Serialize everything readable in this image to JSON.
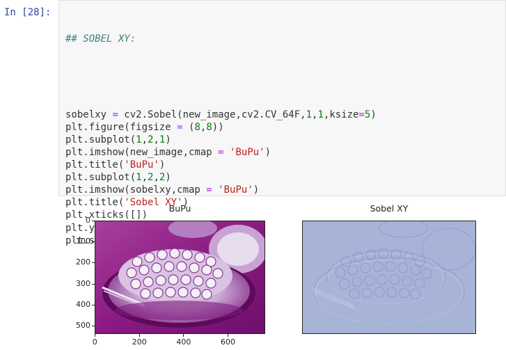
{
  "cell": {
    "prompt": "In [28]:",
    "comment": "## SOBEL XY:",
    "lines": [
      {
        "parts": [
          [
            "plain",
            "sobelxy "
          ],
          [
            "op",
            "="
          ],
          [
            "plain",
            " cv2.Sobel(new_image,cv2.CV_64F,"
          ],
          [
            "num",
            "1"
          ],
          [
            "plain",
            ","
          ],
          [
            "num",
            "1"
          ],
          [
            "plain",
            ",ksize"
          ],
          [
            "op",
            "="
          ],
          [
            "num",
            "5"
          ],
          [
            "plain",
            ")"
          ]
        ]
      },
      {
        "parts": [
          [
            "plain",
            "plt.figure(figsize "
          ],
          [
            "op",
            "="
          ],
          [
            "plain",
            " ("
          ],
          [
            "num",
            "8"
          ],
          [
            "plain",
            ","
          ],
          [
            "num",
            "8"
          ],
          [
            "plain",
            "))"
          ]
        ]
      },
      {
        "parts": [
          [
            "plain",
            "plt.subplot("
          ],
          [
            "num",
            "1"
          ],
          [
            "plain",
            ","
          ],
          [
            "num",
            "2"
          ],
          [
            "plain",
            ","
          ],
          [
            "num",
            "1"
          ],
          [
            "plain",
            ")"
          ]
        ]
      },
      {
        "parts": [
          [
            "plain",
            "plt.imshow(new_image,cmap "
          ],
          [
            "op",
            "="
          ],
          [
            "plain",
            " "
          ],
          [
            "str",
            "'BuPu'"
          ],
          [
            "plain",
            ")"
          ]
        ]
      },
      {
        "parts": [
          [
            "plain",
            "plt.title("
          ],
          [
            "str",
            "'BuPu'"
          ],
          [
            "plain",
            ")"
          ]
        ]
      },
      {
        "parts": [
          [
            "plain",
            "plt.subplot("
          ],
          [
            "num",
            "1"
          ],
          [
            "plain",
            ","
          ],
          [
            "num",
            "2"
          ],
          [
            "plain",
            ","
          ],
          [
            "num",
            "2"
          ],
          [
            "plain",
            ")"
          ]
        ]
      },
      {
        "parts": [
          [
            "plain",
            "plt.imshow(sobelxy,cmap "
          ],
          [
            "op",
            "="
          ],
          [
            "plain",
            " "
          ],
          [
            "str",
            "'BuPu'"
          ],
          [
            "plain",
            ")"
          ]
        ]
      },
      {
        "parts": [
          [
            "plain",
            "plt.title("
          ],
          [
            "str",
            "'Sobel XY'"
          ],
          [
            "plain",
            ")"
          ]
        ]
      },
      {
        "parts": [
          [
            "plain",
            "plt.xticks([])"
          ]
        ]
      },
      {
        "parts": [
          [
            "plain",
            "plt.yticks([])"
          ]
        ]
      },
      {
        "parts": [
          [
            "plain",
            "plt.show()"
          ]
        ]
      }
    ]
  },
  "output": {
    "left_plot": {
      "title": "BuPu",
      "yticks": [
        "0",
        "100",
        "200",
        "300",
        "400",
        "500"
      ],
      "xticks": [
        "0",
        "200",
        "400",
        "600"
      ]
    },
    "right_plot": {
      "title": "Sobel XY"
    }
  },
  "colors": {
    "prompt": "#303f9f",
    "bupu_dark": "#810f7c",
    "bupu_light": "#bfd3e6",
    "sobel_bg": "#a8b3d8"
  }
}
